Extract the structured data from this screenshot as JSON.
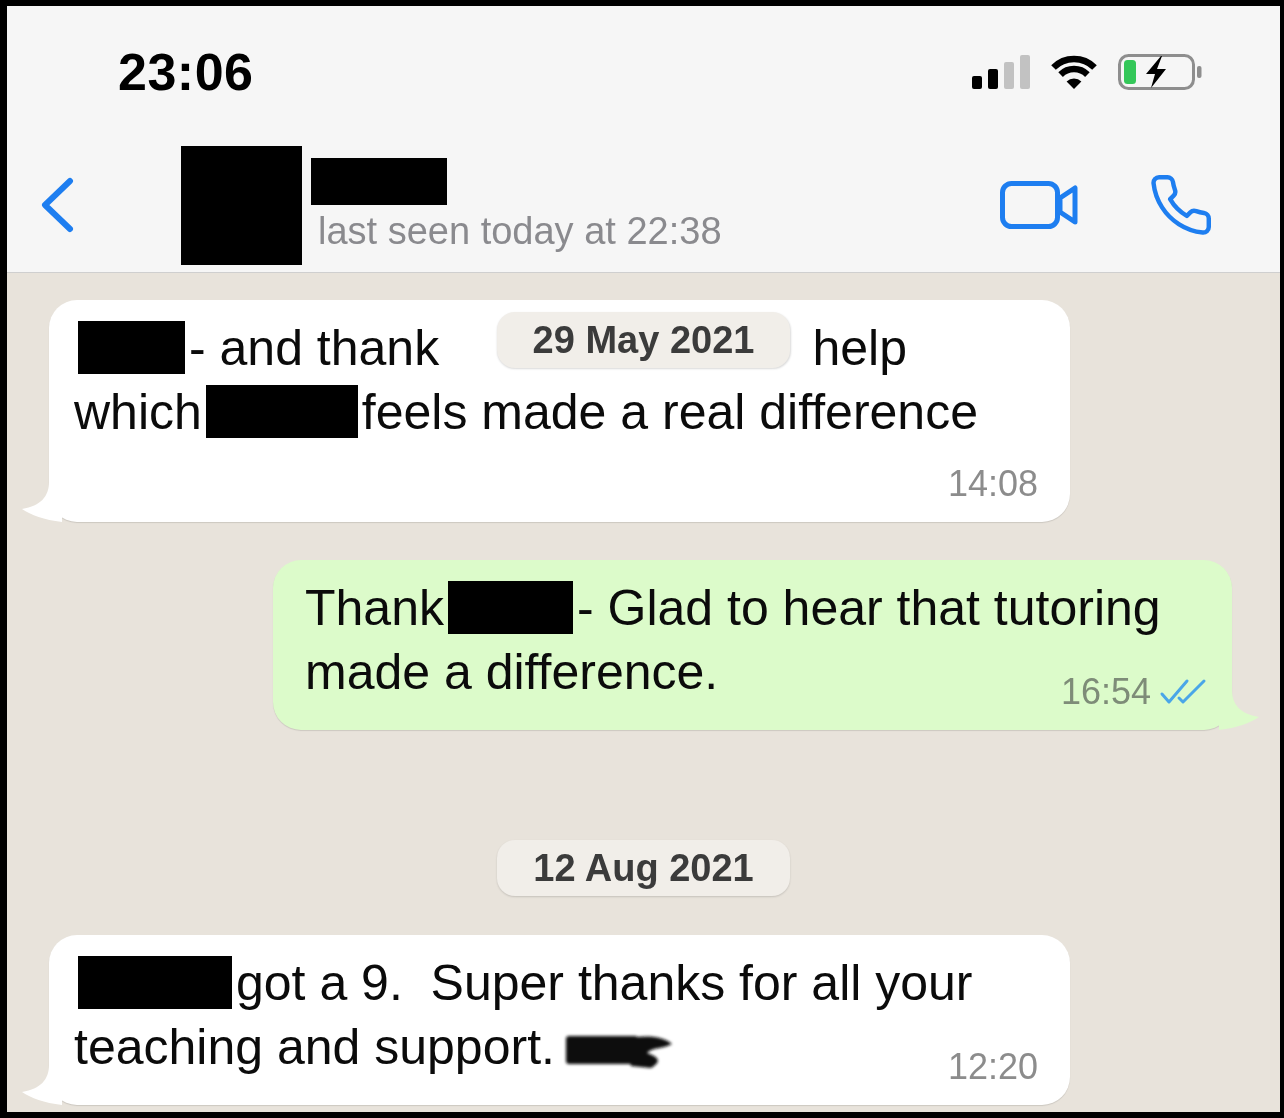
{
  "status_bar": {
    "time": "23:06"
  },
  "chat_header": {
    "avatar_redacted": true,
    "name_redacted": true,
    "last_seen": "last seen today at 22:38"
  },
  "floating_date": {
    "text": "29 May 2021"
  },
  "messages": [
    {
      "kind": "message",
      "outgoing": false,
      "lines": [
        [
          {
            "kind": "redaction"
          },
          {
            "kind": "text",
            "text": "- and thank"
          },
          {
            "kind": "covered"
          },
          {
            "kind": "text",
            "text": "help"
          }
        ],
        [
          {
            "kind": "text",
            "text": "which"
          },
          {
            "kind": "redaction"
          },
          {
            "kind": "text",
            "text": "feels made a real difference"
          }
        ]
      ],
      "time": "14:08"
    },
    {
      "kind": "message",
      "outgoing": true,
      "lines": [
        [
          {
            "kind": "text",
            "text": "Thank"
          },
          {
            "kind": "redaction"
          },
          {
            "kind": "text",
            "text": "- Glad to hear that tutoring"
          }
        ],
        [
          {
            "kind": "text",
            "text": "made a difference."
          }
        ]
      ],
      "time": "16:54",
      "read": true
    },
    {
      "kind": "date",
      "text": "12 Aug 2021"
    },
    {
      "kind": "message",
      "outgoing": false,
      "lines": [
        [
          {
            "kind": "redaction"
          },
          {
            "kind": "text",
            "text": "got a 9.  Super thanks for all your"
          }
        ],
        [
          {
            "kind": "text",
            "text": "teaching and support."
          },
          {
            "kind": "scribble"
          }
        ]
      ],
      "time": "12:20"
    }
  ]
}
